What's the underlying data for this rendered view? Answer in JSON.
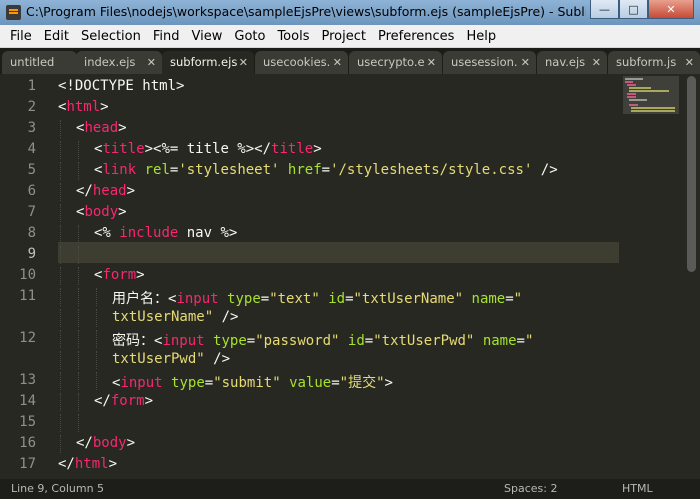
{
  "window": {
    "title": "C:\\Program Files\\nodejs\\workspace\\sampleEjsPre\\views\\subform.ejs (sampleEjsPre) - Sublime Te..."
  },
  "menu": [
    "File",
    "Edit",
    "Selection",
    "Find",
    "View",
    "Goto",
    "Tools",
    "Project",
    "Preferences",
    "Help"
  ],
  "tabs": [
    {
      "label": "untitled",
      "active": false,
      "closable": false
    },
    {
      "label": "index.ejs",
      "active": false,
      "closable": true
    },
    {
      "label": "subform.ejs",
      "active": true,
      "closable": true
    },
    {
      "label": "usecookies.",
      "active": false,
      "closable": true
    },
    {
      "label": "usecrypto.e",
      "active": false,
      "closable": true
    },
    {
      "label": "usesession.",
      "active": false,
      "closable": true
    },
    {
      "label": "nav.ejs",
      "active": false,
      "closable": true
    },
    {
      "label": "subform.js",
      "active": false,
      "closable": true
    }
  ],
  "editor": {
    "line_numbers": [
      "1",
      "2",
      "3",
      "4",
      "5",
      "6",
      "7",
      "8",
      "9",
      "10",
      "11",
      "",
      "12",
      "",
      "13",
      "14",
      "15",
      "16",
      "17"
    ],
    "current_line": "9",
    "lines": [
      {
        "indent": 0,
        "tokens": [
          [
            "plain",
            "<!DOCTYPE html>"
          ]
        ]
      },
      {
        "indent": 0,
        "tokens": [
          [
            "plain",
            "<"
          ],
          [
            "tag",
            "html"
          ],
          [
            "plain",
            ">"
          ]
        ]
      },
      {
        "indent": 1,
        "tokens": [
          [
            "plain",
            "<"
          ],
          [
            "tag",
            "head"
          ],
          [
            "plain",
            ">"
          ]
        ]
      },
      {
        "indent": 2,
        "tokens": [
          [
            "plain",
            "<"
          ],
          [
            "tag",
            "title"
          ],
          [
            "plain",
            "><%= title %></"
          ],
          [
            "tag",
            "title"
          ],
          [
            "plain",
            ">"
          ]
        ]
      },
      {
        "indent": 2,
        "tokens": [
          [
            "plain",
            "<"
          ],
          [
            "tag",
            "link"
          ],
          [
            "plain",
            " "
          ],
          [
            "attr",
            "rel"
          ],
          [
            "plain",
            "="
          ],
          [
            "str",
            "'stylesheet'"
          ],
          [
            "plain",
            " "
          ],
          [
            "attr",
            "href"
          ],
          [
            "plain",
            "="
          ],
          [
            "str",
            "'/stylesheets/style.css'"
          ],
          [
            "plain",
            " />"
          ]
        ]
      },
      {
        "indent": 1,
        "tokens": [
          [
            "plain",
            "</"
          ],
          [
            "tag",
            "head"
          ],
          [
            "plain",
            ">"
          ]
        ]
      },
      {
        "indent": 1,
        "tokens": [
          [
            "plain",
            "<"
          ],
          [
            "tag",
            "body"
          ],
          [
            "plain",
            ">"
          ]
        ]
      },
      {
        "indent": 2,
        "tokens": [
          [
            "plain",
            "<% "
          ],
          [
            "tag",
            "include"
          ],
          [
            "plain",
            " nav %>"
          ]
        ]
      },
      {
        "indent": 2,
        "tokens": []
      },
      {
        "indent": 2,
        "tokens": [
          [
            "plain",
            "<"
          ],
          [
            "tag",
            "form"
          ],
          [
            "plain",
            ">"
          ]
        ]
      },
      {
        "indent": 3,
        "tokens": [
          [
            "plain",
            "用户名："
          ],
          [
            "plain",
            "<"
          ],
          [
            "tag",
            "input"
          ],
          [
            "plain",
            " "
          ],
          [
            "attr",
            "type"
          ],
          [
            "plain",
            "="
          ],
          [
            "str",
            "\"text\""
          ],
          [
            "plain",
            " "
          ],
          [
            "attr",
            "id"
          ],
          [
            "plain",
            "="
          ],
          [
            "str",
            "\"txtUserName\""
          ],
          [
            "plain",
            " "
          ],
          [
            "attr",
            "name"
          ],
          [
            "plain",
            "="
          ],
          [
            "str",
            "\""
          ]
        ]
      },
      {
        "indent": 3,
        "tokens": [
          [
            "str",
            "txtUserName\""
          ],
          [
            "plain",
            " />"
          ]
        ]
      },
      {
        "indent": 3,
        "tokens": [
          [
            "plain",
            "密码："
          ],
          [
            "plain",
            "<"
          ],
          [
            "tag",
            "input"
          ],
          [
            "plain",
            " "
          ],
          [
            "attr",
            "type"
          ],
          [
            "plain",
            "="
          ],
          [
            "str",
            "\"password\""
          ],
          [
            "plain",
            " "
          ],
          [
            "attr",
            "id"
          ],
          [
            "plain",
            "="
          ],
          [
            "str",
            "\"txtUserPwd\""
          ],
          [
            "plain",
            " "
          ],
          [
            "attr",
            "name"
          ],
          [
            "plain",
            "="
          ],
          [
            "str",
            "\""
          ]
        ]
      },
      {
        "indent": 3,
        "tokens": [
          [
            "str",
            "txtUserPwd\""
          ],
          [
            "plain",
            " />"
          ]
        ]
      },
      {
        "indent": 3,
        "tokens": [
          [
            "plain",
            "<"
          ],
          [
            "tag",
            "input"
          ],
          [
            "plain",
            " "
          ],
          [
            "attr",
            "type"
          ],
          [
            "plain",
            "="
          ],
          [
            "str",
            "\"submit\""
          ],
          [
            "plain",
            " "
          ],
          [
            "attr",
            "value"
          ],
          [
            "plain",
            "="
          ],
          [
            "str",
            "\"提交\""
          ],
          [
            "plain",
            ">"
          ]
        ]
      },
      {
        "indent": 2,
        "tokens": [
          [
            "plain",
            "</"
          ],
          [
            "tag",
            "form"
          ],
          [
            "plain",
            ">"
          ]
        ]
      },
      {
        "indent": 2,
        "tokens": []
      },
      {
        "indent": 1,
        "tokens": [
          [
            "plain",
            "</"
          ],
          [
            "tag",
            "body"
          ],
          [
            "plain",
            ">"
          ]
        ]
      },
      {
        "indent": 0,
        "tokens": [
          [
            "plain",
            "</"
          ],
          [
            "tag",
            "html"
          ],
          [
            "plain",
            ">"
          ]
        ]
      }
    ]
  },
  "status": {
    "position": "Line 9, Column 5",
    "spaces": "Spaces: 2",
    "syntax": "HTML"
  },
  "colors": {
    "background": "#272822",
    "tag": "#f92672",
    "attribute": "#a6e22e",
    "string": "#e6db74",
    "text": "#f8f8f2",
    "line_number": "#90908a"
  }
}
